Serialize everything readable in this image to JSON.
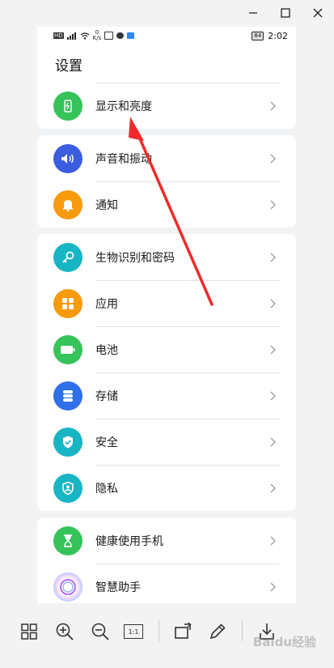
{
  "window": {
    "controls": [
      "minimize",
      "maximize",
      "close"
    ]
  },
  "status_bar": {
    "left_small": "HD",
    "speed_value": "0",
    "speed_unit": "K/s",
    "battery": "84",
    "time": "2:02"
  },
  "settings": {
    "title": "设置",
    "groups": [
      {
        "items": [
          {
            "label": "显示和亮度",
            "icon": "display-icon",
            "color": "#35c35a"
          }
        ]
      },
      {
        "items": [
          {
            "label": "声音和振动",
            "icon": "speaker-icon",
            "color": "#3b5de0"
          },
          {
            "label": "通知",
            "icon": "bell-icon",
            "color": "#f79a0b"
          }
        ]
      },
      {
        "items": [
          {
            "label": "生物识别和密码",
            "icon": "key-icon",
            "color": "#18b5c4"
          },
          {
            "label": "应用",
            "icon": "apps-icon",
            "color": "#f79a0b"
          },
          {
            "label": "电池",
            "icon": "battery-icon",
            "color": "#35c35a"
          },
          {
            "label": "存储",
            "icon": "storage-icon",
            "color": "#2f6fe8"
          },
          {
            "label": "安全",
            "icon": "shield-icon",
            "color": "#18b5c4"
          },
          {
            "label": "隐私",
            "icon": "privacy-icon",
            "color": "#18b5c4"
          }
        ]
      },
      {
        "items": [
          {
            "label": "健康使用手机",
            "icon": "hourglass-icon",
            "color": "#35c35a"
          },
          {
            "label": "智慧助手",
            "icon": "assistant-icon",
            "color": "#b86cf0"
          }
        ]
      }
    ]
  },
  "toolbar": {
    "actual_size_label": "1:1"
  },
  "watermark": "Baidu经验",
  "colors": {
    "annotation_arrow": "#f02a2a",
    "chevron": "#9a9a9a"
  }
}
